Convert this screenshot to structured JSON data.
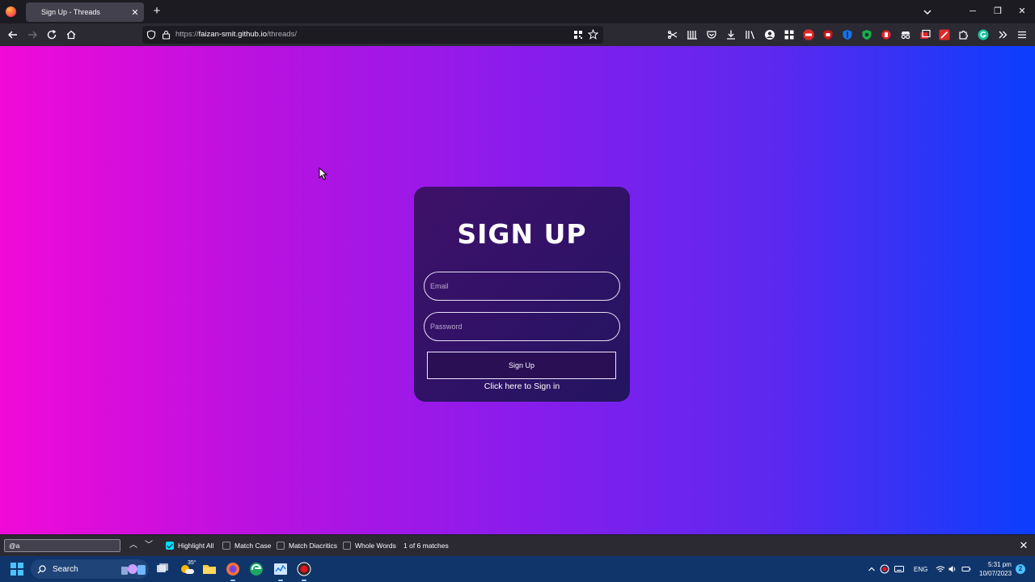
{
  "browser": {
    "tab_title": "Sign Up - Threads",
    "url_scheme": "https://",
    "url_host": "faizan-smit.github.io",
    "url_path": "/threads/"
  },
  "signup_card": {
    "title": "SIGN UP",
    "email_placeholder": "Email",
    "password_placeholder": "Password",
    "button_label": "Sign Up",
    "signin_link": "Click here to Sign in"
  },
  "findbar": {
    "query": "@a",
    "highlight_all": "Highlight All",
    "highlight_all_checked": true,
    "match_case": "Match Case",
    "match_diacritics": "Match Diacritics",
    "whole_words": "Whole Words",
    "result_count": "1 of 6 matches"
  },
  "taskbar": {
    "search_label": "Search",
    "weather_temp": "35°",
    "language": "ENG",
    "time": "5:31 pm",
    "date": "10/07/2023",
    "notification_count": "2"
  },
  "colors": {
    "page_gradient_start": "#f10ad8",
    "page_gradient_end": "#0b3efd",
    "card_background": "#311267"
  }
}
